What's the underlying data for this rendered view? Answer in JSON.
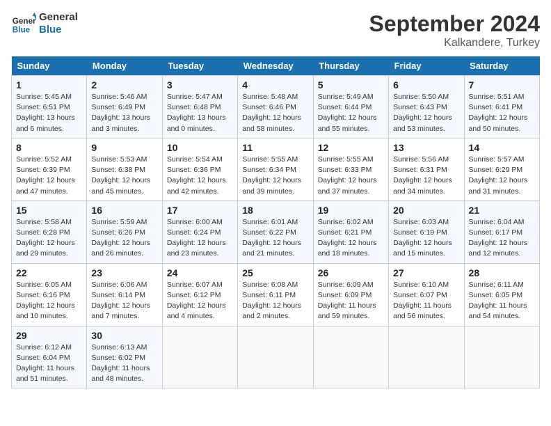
{
  "header": {
    "logo_line1": "General",
    "logo_line2": "Blue",
    "month": "September 2024",
    "location": "Kalkandere, Turkey"
  },
  "weekdays": [
    "Sunday",
    "Monday",
    "Tuesday",
    "Wednesday",
    "Thursday",
    "Friday",
    "Saturday"
  ],
  "weeks": [
    [
      {
        "day": "1",
        "sunrise": "Sunrise: 5:45 AM",
        "sunset": "Sunset: 6:51 PM",
        "daylight": "Daylight: 13 hours and 6 minutes."
      },
      {
        "day": "2",
        "sunrise": "Sunrise: 5:46 AM",
        "sunset": "Sunset: 6:49 PM",
        "daylight": "Daylight: 13 hours and 3 minutes."
      },
      {
        "day": "3",
        "sunrise": "Sunrise: 5:47 AM",
        "sunset": "Sunset: 6:48 PM",
        "daylight": "Daylight: 13 hours and 0 minutes."
      },
      {
        "day": "4",
        "sunrise": "Sunrise: 5:48 AM",
        "sunset": "Sunset: 6:46 PM",
        "daylight": "Daylight: 12 hours and 58 minutes."
      },
      {
        "day": "5",
        "sunrise": "Sunrise: 5:49 AM",
        "sunset": "Sunset: 6:44 PM",
        "daylight": "Daylight: 12 hours and 55 minutes."
      },
      {
        "day": "6",
        "sunrise": "Sunrise: 5:50 AM",
        "sunset": "Sunset: 6:43 PM",
        "daylight": "Daylight: 12 hours and 53 minutes."
      },
      {
        "day": "7",
        "sunrise": "Sunrise: 5:51 AM",
        "sunset": "Sunset: 6:41 PM",
        "daylight": "Daylight: 12 hours and 50 minutes."
      }
    ],
    [
      {
        "day": "8",
        "sunrise": "Sunrise: 5:52 AM",
        "sunset": "Sunset: 6:39 PM",
        "daylight": "Daylight: 12 hours and 47 minutes."
      },
      {
        "day": "9",
        "sunrise": "Sunrise: 5:53 AM",
        "sunset": "Sunset: 6:38 PM",
        "daylight": "Daylight: 12 hours and 45 minutes."
      },
      {
        "day": "10",
        "sunrise": "Sunrise: 5:54 AM",
        "sunset": "Sunset: 6:36 PM",
        "daylight": "Daylight: 12 hours and 42 minutes."
      },
      {
        "day": "11",
        "sunrise": "Sunrise: 5:55 AM",
        "sunset": "Sunset: 6:34 PM",
        "daylight": "Daylight: 12 hours and 39 minutes."
      },
      {
        "day": "12",
        "sunrise": "Sunrise: 5:55 AM",
        "sunset": "Sunset: 6:33 PM",
        "daylight": "Daylight: 12 hours and 37 minutes."
      },
      {
        "day": "13",
        "sunrise": "Sunrise: 5:56 AM",
        "sunset": "Sunset: 6:31 PM",
        "daylight": "Daylight: 12 hours and 34 minutes."
      },
      {
        "day": "14",
        "sunrise": "Sunrise: 5:57 AM",
        "sunset": "Sunset: 6:29 PM",
        "daylight": "Daylight: 12 hours and 31 minutes."
      }
    ],
    [
      {
        "day": "15",
        "sunrise": "Sunrise: 5:58 AM",
        "sunset": "Sunset: 6:28 PM",
        "daylight": "Daylight: 12 hours and 29 minutes."
      },
      {
        "day": "16",
        "sunrise": "Sunrise: 5:59 AM",
        "sunset": "Sunset: 6:26 PM",
        "daylight": "Daylight: 12 hours and 26 minutes."
      },
      {
        "day": "17",
        "sunrise": "Sunrise: 6:00 AM",
        "sunset": "Sunset: 6:24 PM",
        "daylight": "Daylight: 12 hours and 23 minutes."
      },
      {
        "day": "18",
        "sunrise": "Sunrise: 6:01 AM",
        "sunset": "Sunset: 6:22 PM",
        "daylight": "Daylight: 12 hours and 21 minutes."
      },
      {
        "day": "19",
        "sunrise": "Sunrise: 6:02 AM",
        "sunset": "Sunset: 6:21 PM",
        "daylight": "Daylight: 12 hours and 18 minutes."
      },
      {
        "day": "20",
        "sunrise": "Sunrise: 6:03 AM",
        "sunset": "Sunset: 6:19 PM",
        "daylight": "Daylight: 12 hours and 15 minutes."
      },
      {
        "day": "21",
        "sunrise": "Sunrise: 6:04 AM",
        "sunset": "Sunset: 6:17 PM",
        "daylight": "Daylight: 12 hours and 12 minutes."
      }
    ],
    [
      {
        "day": "22",
        "sunrise": "Sunrise: 6:05 AM",
        "sunset": "Sunset: 6:16 PM",
        "daylight": "Daylight: 12 hours and 10 minutes."
      },
      {
        "day": "23",
        "sunrise": "Sunrise: 6:06 AM",
        "sunset": "Sunset: 6:14 PM",
        "daylight": "Daylight: 12 hours and 7 minutes."
      },
      {
        "day": "24",
        "sunrise": "Sunrise: 6:07 AM",
        "sunset": "Sunset: 6:12 PM",
        "daylight": "Daylight: 12 hours and 4 minutes."
      },
      {
        "day": "25",
        "sunrise": "Sunrise: 6:08 AM",
        "sunset": "Sunset: 6:11 PM",
        "daylight": "Daylight: 12 hours and 2 minutes."
      },
      {
        "day": "26",
        "sunrise": "Sunrise: 6:09 AM",
        "sunset": "Sunset: 6:09 PM",
        "daylight": "Daylight: 11 hours and 59 minutes."
      },
      {
        "day": "27",
        "sunrise": "Sunrise: 6:10 AM",
        "sunset": "Sunset: 6:07 PM",
        "daylight": "Daylight: 11 hours and 56 minutes."
      },
      {
        "day": "28",
        "sunrise": "Sunrise: 6:11 AM",
        "sunset": "Sunset: 6:05 PM",
        "daylight": "Daylight: 11 hours and 54 minutes."
      }
    ],
    [
      {
        "day": "29",
        "sunrise": "Sunrise: 6:12 AM",
        "sunset": "Sunset: 6:04 PM",
        "daylight": "Daylight: 11 hours and 51 minutes."
      },
      {
        "day": "30",
        "sunrise": "Sunrise: 6:13 AM",
        "sunset": "Sunset: 6:02 PM",
        "daylight": "Daylight: 11 hours and 48 minutes."
      },
      null,
      null,
      null,
      null,
      null
    ]
  ]
}
